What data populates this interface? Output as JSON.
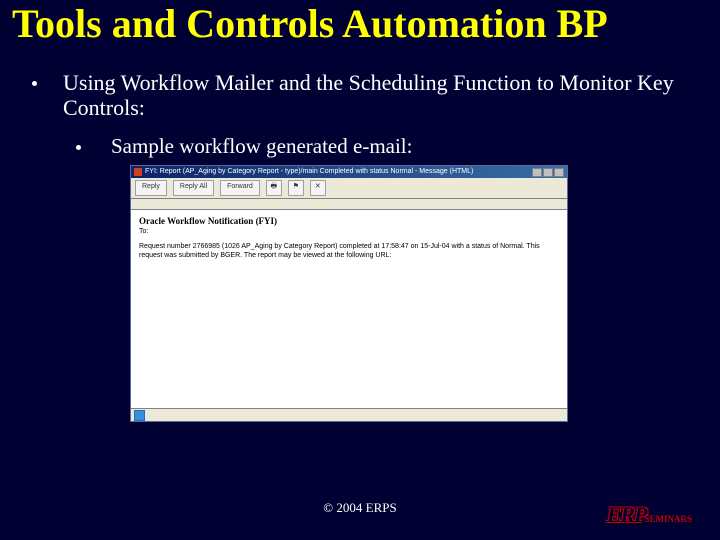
{
  "title": "Tools and Controls Automation BP",
  "bullets": {
    "lvl1": "Using Workflow Mailer and the Scheduling Function to Monitor Key Controls:",
    "lvl2": "Sample workflow generated e-mail:"
  },
  "shot": {
    "window_title": "FYI: Report   (AP_Aging by Category Report - type)/main Completed with status Normal   - Message (HTML)",
    "toolbar": {
      "reply": "Reply",
      "reply_all": "Reply All",
      "forward": "Forward",
      "print_icon": "🖶",
      "flag_icon": "⚑",
      "x_icon": "✕"
    },
    "mail": {
      "heading": "Oracle Workflow Notification (FYI)",
      "to": "To:",
      "body": "Request number 2766985 (1026 AP_Aging by Category Report) completed at 17:58:47 on 15-Jul-04 with a status of Normal. This request was submitted by BGER. The report may be viewed at the following URL:"
    }
  },
  "footer": "© 2004 ERPS",
  "logo": {
    "main": "ERP",
    "sub": "SEMINARS"
  }
}
